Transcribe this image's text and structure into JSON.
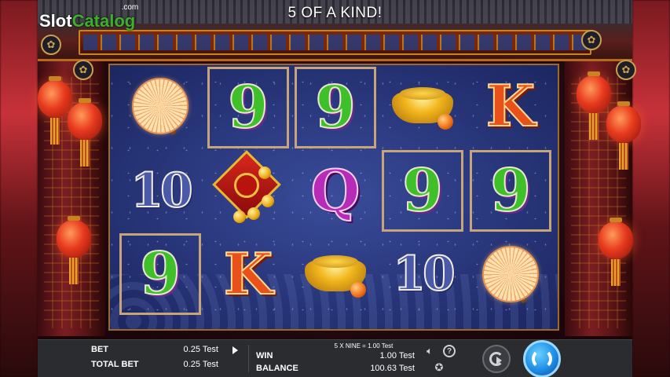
{
  "logo": {
    "part1": "Slot",
    "part2": "Catalog",
    "suffix": ".com"
  },
  "header": {
    "title": "5 OF A KIND!"
  },
  "reels": [
    [
      "fan",
      "10",
      "9"
    ],
    [
      "9",
      "scatter",
      "K"
    ],
    [
      "9",
      "Q",
      "ingot"
    ],
    [
      "ingot",
      "9",
      "10"
    ],
    [
      "K",
      "9",
      "fan"
    ]
  ],
  "winning_cells": [
    [
      0,
      1
    ],
    [
      0,
      2
    ],
    [
      1,
      3
    ],
    [
      1,
      4
    ],
    [
      2,
      0
    ]
  ],
  "bottom_bar": {
    "bet_label": "BET",
    "bet_value": "0.25 Test",
    "total_bet_label": "TOTAL BET",
    "total_bet_value": "0.25 Test",
    "win_line_text": "5 X NINE = 1.00 Test",
    "win_label": "WIN",
    "win_value": "1.00 Test",
    "balance_label": "BALANCE",
    "balance_value": "100.63 Test",
    "sound_icon": "speaker-icon",
    "help_icon": "question-icon",
    "help_glyph": "?",
    "settings_icon": "star-settings-icon",
    "autoplay_icon": "autoplay-icon",
    "spin_icon": "spin-icon"
  },
  "colors": {
    "spin_button": "#1e8ee8",
    "bar_bg": "#2a2c30",
    "win_frame": "#c8a47a",
    "reel_bg": "#28367a"
  }
}
